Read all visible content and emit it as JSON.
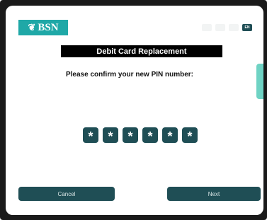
{
  "brand": {
    "logo_text": "BSN",
    "logo_icon": "pinecone-icon",
    "color": "#1fa8a7"
  },
  "languages": [
    {
      "label": "",
      "active": false
    },
    {
      "label": "",
      "active": false
    },
    {
      "label": "",
      "active": false
    },
    {
      "label": "EN",
      "active": true
    }
  ],
  "screen": {
    "title": "Debit Card Replacement",
    "prompt": "Please confirm your new PIN number:"
  },
  "pin": {
    "masked_digits": [
      "*",
      "*",
      "*",
      "*",
      "*",
      "*"
    ]
  },
  "buttons": {
    "cancel_label": "Cancel",
    "next_label": "Next"
  },
  "colors": {
    "button": "#1f4e55",
    "title_bar": "#000000",
    "accent": "#6fd3c4"
  }
}
